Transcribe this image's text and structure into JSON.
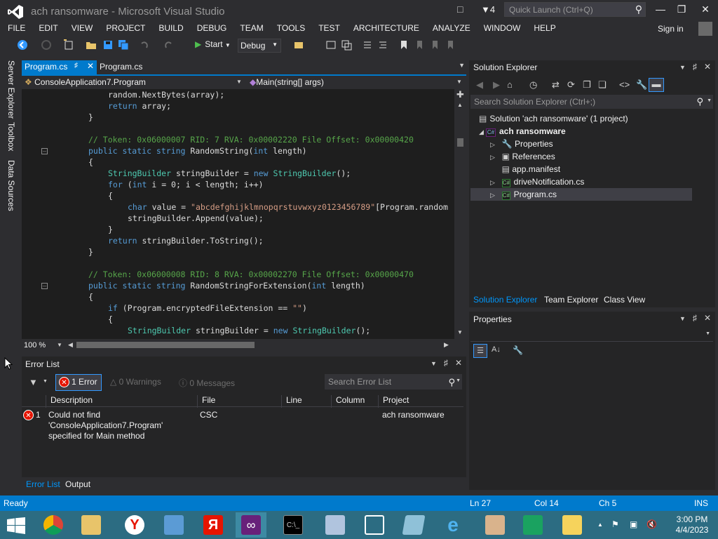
{
  "window": {
    "title": "ach ransomware - Microsoft Visual Studio",
    "notification_count": "4",
    "quick_launch_placeholder": "Quick Launch (Ctrl+Q)"
  },
  "menu": [
    "FILE",
    "EDIT",
    "VIEW",
    "PROJECT",
    "BUILD",
    "DEBUG",
    "TEAM",
    "TOOLS",
    "TEST",
    "ARCHITECTURE",
    "ANALYZE",
    "WINDOW",
    "HELP"
  ],
  "account": {
    "sign_in": "Sign in"
  },
  "toolbar": {
    "start_label": "Start",
    "configuration": "Debug"
  },
  "side_tabs": [
    "Server Explorer",
    "Toolbox",
    "Data Sources"
  ],
  "editor": {
    "active_tab": "Program.cs",
    "inactive_tab": "Program.cs",
    "nav_class": "ConsoleApplication7.Program",
    "nav_member": "Main(string[] args)",
    "zoom": "100 %"
  },
  "error_list": {
    "title": "Error List",
    "errors_label": "1 Error",
    "warnings_label": "0 Warnings",
    "messages_label": "0 Messages",
    "search_placeholder": "Search Error List",
    "columns": [
      "Description",
      "File",
      "Line",
      "Column",
      "Project"
    ],
    "rows": [
      {
        "index": "1",
        "description_lines": [
          "Could not find",
          "'ConsoleApplication7.Program'",
          "specified for Main method"
        ],
        "file": "CSC",
        "line": "",
        "column": "",
        "project": "ach ransomware"
      }
    ],
    "bottom_tabs": [
      "Error List",
      "Output"
    ]
  },
  "solution_explorer": {
    "title": "Solution Explorer",
    "search_placeholder": "Search Solution Explorer (Ctrl+;)",
    "solution": "Solution 'ach ransomware' (1 project)",
    "project": "ach ransomware",
    "items": [
      "Properties",
      "References",
      "app.manifest",
      "driveNotification.cs",
      "Program.cs"
    ],
    "tabs": [
      "Solution Explorer",
      "Team Explorer",
      "Class View"
    ]
  },
  "properties": {
    "title": "Properties"
  },
  "status": {
    "state": "Ready",
    "ln": "Ln 27",
    "col": "Col 14",
    "ch": "Ch 5",
    "mode": "INS"
  },
  "clock": {
    "time": "3:00 PM",
    "date": "4/4/2023"
  },
  "colors": {
    "accent": "#007acc",
    "error": "#e51400",
    "taskbar": "#2c6c82"
  }
}
